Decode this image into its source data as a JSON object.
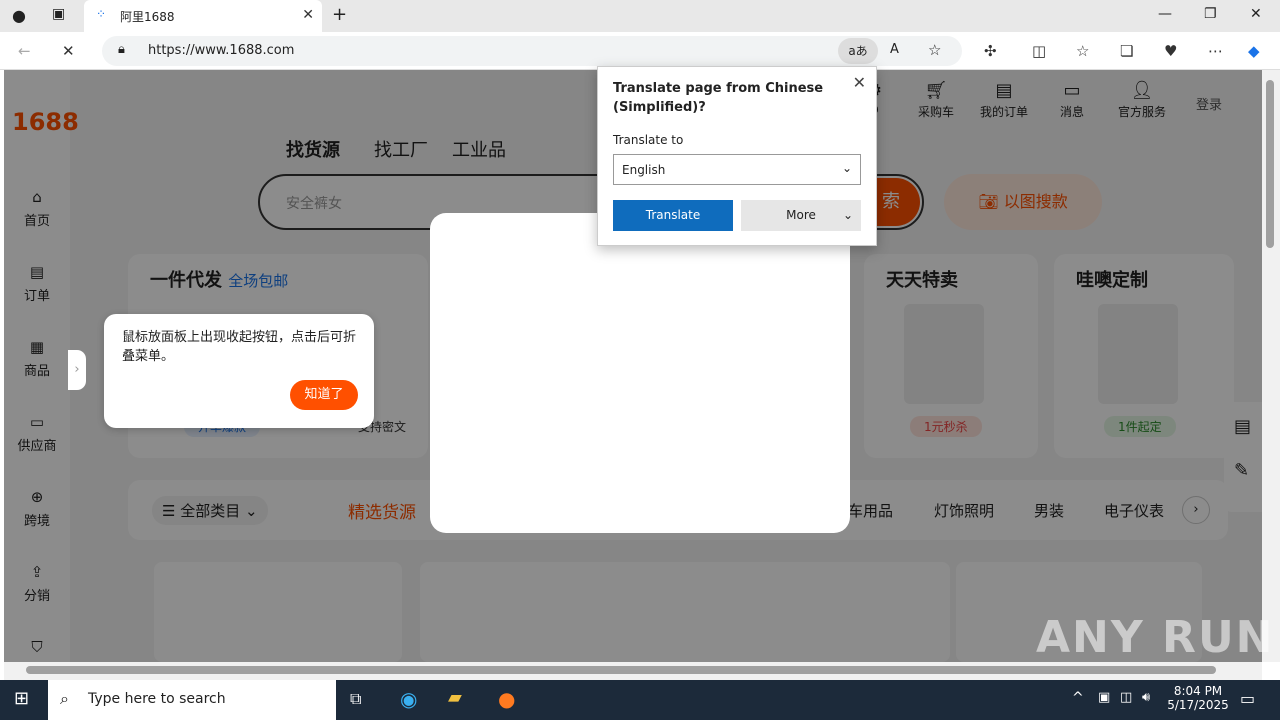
{
  "browser": {
    "tab_title": "阿里1688",
    "url": "https://www.1688.com",
    "window_controls": [
      "minimize",
      "restore",
      "close"
    ]
  },
  "page": {
    "logo": "1688",
    "sidebar": [
      {
        "label": "首页",
        "icon": "home-icon"
      },
      {
        "label": "订单",
        "icon": "order-icon"
      },
      {
        "label": "商品",
        "icon": "grid-icon"
      },
      {
        "label": "供应商",
        "icon": "store-icon"
      },
      {
        "label": "跨境",
        "icon": "globe-icon"
      },
      {
        "label": "分销",
        "icon": "share-icon"
      }
    ],
    "nav_tabs": [
      "找货源",
      "找工厂",
      "工业品"
    ],
    "search_placeholder": "安全裤女",
    "search_button": "索",
    "image_search": "以图搜款",
    "top_nav": [
      {
        "label": "D",
        "icon": "d-icon"
      },
      {
        "label": "采购车",
        "icon": "cart-icon"
      },
      {
        "label": "我的订单",
        "icon": "clipboard-icon"
      },
      {
        "label": "消息",
        "icon": "message-icon"
      },
      {
        "label": "官方服务",
        "icon": "user-icon"
      }
    ],
    "login": "登录",
    "cards": [
      {
        "title": "一件代发",
        "subtitle": "全场包邮",
        "badge1": "开单爆款",
        "badge2": "支持密文"
      },
      {
        "title": "天天特卖",
        "badge": "1元秒杀"
      },
      {
        "title": "哇噢定制",
        "badge": "1件起定"
      }
    ],
    "categories": [
      "全部类目",
      "精选货源",
      "车用品",
      "灯饰照明",
      "男装",
      "电子仪表"
    ],
    "tooltip": {
      "text": "鼠标放面板上出现收起按钮，点击后可折叠菜单。",
      "button": "知道了"
    }
  },
  "translate_popup": {
    "heading": "Translate page from Chinese (Simplified)?",
    "translate_to_label": "Translate to",
    "language": "English",
    "translate_button": "Translate",
    "more_button": "More"
  },
  "taskbar": {
    "search_placeholder": "Type here to search",
    "time": "8:04 PM",
    "date": "5/17/2025"
  },
  "watermark": "ANY RUN"
}
